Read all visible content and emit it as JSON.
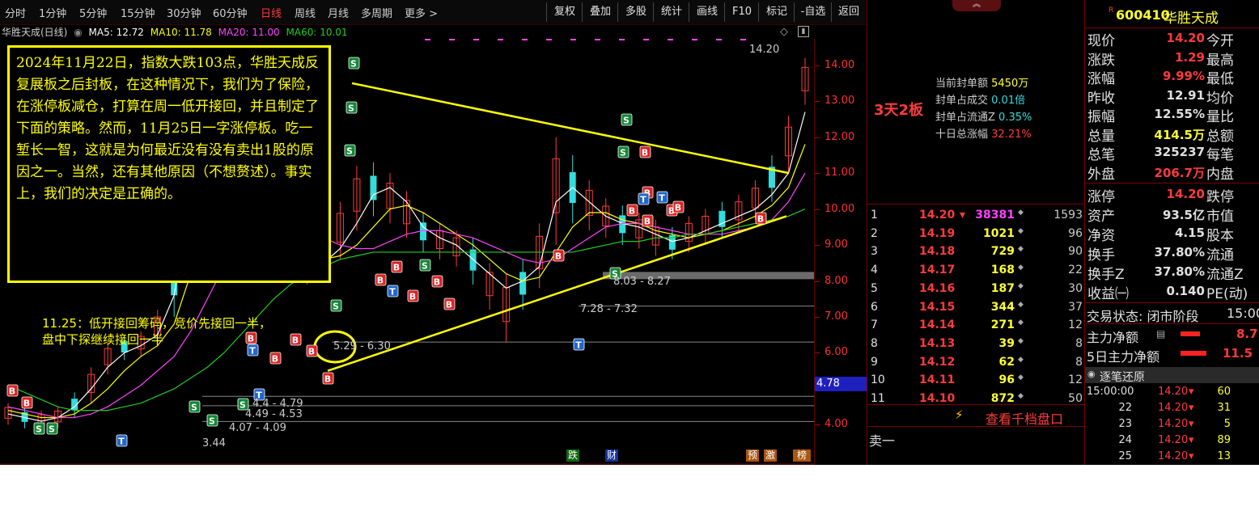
{
  "toolbar": {
    "periods": [
      "分时",
      "1分钟",
      "5分钟",
      "15分钟",
      "30分钟",
      "60分钟",
      "日线",
      "周线",
      "月线",
      "多周期",
      "更多 >"
    ],
    "active_period": "日线",
    "tools": [
      "复权",
      "叠加",
      "多股",
      "统计",
      "画线",
      "F10",
      "标记",
      "-自选",
      "返回"
    ]
  },
  "statusline": {
    "stock": "华胜天成(日线)",
    "ma5": "MA5: 12.72",
    "ma10": "MA10: 11.78",
    "ma20": "MA20: 11.00",
    "ma60": "MA60: 10.01"
  },
  "annotation": {
    "main_text": "2024年11月22日，指数大跌103点，华胜天成反复展板之后封板，在这种情况下，我们为了保险，在涨停板减仓，打算在周一低开接回，并且制定了下面的策略。然而，11月25日一字涨停板。吃一堑长一智，这就是为何最近没有没有卖出1股的原因之一。当然，还有其他原因（不想赘述）。事实上，我们的决定是正确的。",
    "strategy_line1": "11.25：低开接回筹码，竞价先接回一半，",
    "strategy_line2": "盘中下探继续接回一半"
  },
  "chart_labels": {
    "high_label": "14.20",
    "range1": "8.03 - 8.27",
    "range2": "7.28 - 7.32",
    "range3": "5.29 - 6.30",
    "range4": "4.4 - 4.79",
    "range5": "4.49 - 4.53",
    "range6": "4.07 - 4.09",
    "low_label": "3.44",
    "current_price_box": "4.78",
    "bottom_markers": [
      "跌",
      "财",
      "预",
      "激",
      "榜"
    ]
  },
  "chart_data": {
    "type": "line",
    "series": [
      {
        "name": "MA5",
        "values": [
          4.3,
          4.2,
          4.1,
          4.2,
          4.5,
          5.0,
          5.6,
          6.0,
          6.2,
          6.5,
          7.6,
          10.5,
          12.0,
          11.2,
          10.0,
          9.2,
          8.8,
          8.6,
          8.4,
          8.5,
          8.9,
          9.6,
          10.4,
          10.6,
          10.2,
          9.5,
          9.2,
          9.0,
          8.6,
          8.2,
          7.8,
          8.0,
          8.4,
          10.2,
          10.6,
          10.2,
          9.8,
          9.6,
          9.5,
          9.3,
          9.1,
          9.2,
          9.4,
          9.6,
          9.8,
          10.0,
          10.4,
          11.0,
          12.7
        ]
      },
      {
        "name": "MA10",
        "values": [
          4.4,
          4.3,
          4.2,
          4.2,
          4.3,
          4.6,
          5.0,
          5.5,
          5.9,
          6.2,
          6.8,
          8.2,
          9.6,
          10.6,
          10.8,
          10.2,
          9.4,
          9.0,
          8.7,
          8.6,
          8.7,
          9.0,
          9.5,
          10.0,
          10.1,
          9.9,
          9.6,
          9.3,
          9.0,
          8.6,
          8.2,
          8.0,
          8.1,
          8.8,
          9.5,
          9.9,
          9.9,
          9.7,
          9.6,
          9.4,
          9.3,
          9.2,
          9.3,
          9.4,
          9.6,
          9.8,
          10.1,
          10.6,
          11.8
        ]
      },
      {
        "name": "MA20",
        "values": [
          4.5,
          4.4,
          4.3,
          4.2,
          4.2,
          4.3,
          4.5,
          4.8,
          5.1,
          5.5,
          5.9,
          6.6,
          7.5,
          8.4,
          9.1,
          9.6,
          9.7,
          9.6,
          9.4,
          9.2,
          9.0,
          8.9,
          8.9,
          9.1,
          9.3,
          9.4,
          9.4,
          9.3,
          9.2,
          9.0,
          8.8,
          8.6,
          8.5,
          8.6,
          8.9,
          9.2,
          9.5,
          9.6,
          9.6,
          9.5,
          9.4,
          9.3,
          9.3,
          9.3,
          9.4,
          9.5,
          9.7,
          10.2,
          11.0
        ]
      },
      {
        "name": "MA60",
        "values": [
          5.1,
          4.9,
          4.7,
          4.5,
          4.4,
          4.4,
          4.4,
          4.5,
          4.6,
          4.8,
          5.0,
          5.3,
          5.6,
          6.0,
          6.5,
          7.0,
          7.5,
          7.9,
          8.2,
          8.4,
          8.6,
          8.7,
          8.8,
          8.8,
          8.8,
          8.8,
          8.8,
          8.8,
          8.8,
          8.8,
          8.8,
          8.8,
          8.8,
          8.8,
          8.8,
          8.9,
          9.0,
          9.1,
          9.1,
          9.2,
          9.2,
          9.3,
          9.3,
          9.4,
          9.5,
          9.6,
          9.7,
          9.8,
          10.0
        ]
      }
    ],
    "ylim": [
      3.2,
      14.6
    ],
    "yticks": [
      4.0,
      5.0,
      6.0,
      7.0,
      8.0,
      9.0,
      10.0,
      11.0,
      12.0,
      13.0,
      14.0
    ],
    "ytick_labels": [
      "4.00",
      "5.00",
      "6.00",
      "7.00",
      "8.00",
      "9.00",
      "10.00",
      "11.00",
      "12.00",
      "13.00",
      "14.00"
    ],
    "highs": [
      4.6,
      4.5,
      4.4,
      4.5,
      4.9,
      5.6,
      6.3,
      6.5,
      6.6,
      7.2,
      9.0,
      13.6,
      13.2,
      11.6,
      10.4,
      9.6,
      9.0,
      8.8,
      8.7,
      9.2,
      10.2,
      11.2,
      11.3,
      11.0,
      10.5,
      9.9,
      9.6,
      9.4,
      9.2,
      8.5,
      8.2,
      8.6,
      9.6,
      12.0,
      11.5,
      10.8,
      10.3,
      10.1,
      9.9,
      9.7,
      9.5,
      9.8,
      10.0,
      10.2,
      10.4,
      10.8,
      11.5,
      12.6,
      14.2
    ],
    "lows": [
      4.0,
      3.9,
      3.8,
      3.9,
      4.2,
      4.6,
      5.4,
      5.8,
      5.9,
      6.2,
      7.0,
      9.8,
      10.6,
      9.6,
      8.8,
      8.3,
      8.1,
      8.0,
      7.9,
      8.1,
      8.6,
      9.4,
      9.8,
      9.6,
      9.2,
      8.8,
      8.6,
      8.4,
      7.9,
      7.2,
      6.3,
      7.2,
      7.8,
      9.0,
      9.6,
      9.4,
      9.2,
      9.0,
      8.9,
      8.7,
      8.6,
      8.8,
      9.0,
      9.2,
      9.4,
      9.7,
      10.2,
      11.0,
      12.9
    ],
    "trend_upper": {
      "from": [
        11,
        13.5
      ],
      "to": [
        46,
        11.0
      ]
    },
    "trend_lower": {
      "from": [
        9,
        5.5
      ],
      "to": [
        47,
        9.8
      ]
    },
    "hlines": [
      8.15,
      7.3,
      6.3,
      4.79,
      4.53,
      4.09
    ]
  },
  "mid_panel": {
    "streak": "3天2板",
    "stats": [
      {
        "label": "当前封单额",
        "value": "5450万"
      },
      {
        "label": "封单占成交",
        "value": "0.01倍"
      },
      {
        "label": "封单占流通Z",
        "value": "0.35%"
      },
      {
        "label": "十日总涨幅",
        "value": "32.21%"
      }
    ],
    "buy_levels": [
      {
        "n": "1",
        "price": "14.20",
        "vol": "38381",
        "num": "1593"
      },
      {
        "n": "2",
        "price": "14.19",
        "vol": "1021",
        "num": "96"
      },
      {
        "n": "3",
        "price": "14.18",
        "vol": "729",
        "num": "90"
      },
      {
        "n": "4",
        "price": "14.17",
        "vol": "168",
        "num": "22"
      },
      {
        "n": "5",
        "price": "14.16",
        "vol": "187",
        "num": "30"
      },
      {
        "n": "6",
        "price": "14.15",
        "vol": "344",
        "num": "37"
      },
      {
        "n": "7",
        "price": "14.14",
        "vol": "271",
        "num": "12"
      },
      {
        "n": "8",
        "price": "14.13",
        "vol": "39",
        "num": "8"
      },
      {
        "n": "9",
        "price": "14.12",
        "vol": "62",
        "num": "8"
      },
      {
        "n": "10",
        "price": "14.11",
        "vol": "96",
        "num": "12"
      },
      {
        "n": "11",
        "price": "14.10",
        "vol": "872",
        "num": "50"
      }
    ],
    "depth_link": "查看千档盘口",
    "sell_one": "卖一"
  },
  "right_panel": {
    "code": "600410",
    "name": "华胜天成",
    "rows": [
      {
        "l": "现价",
        "v": "14.20",
        "r": "今开",
        "c": "#ff3b3b"
      },
      {
        "l": "涨跌",
        "v": "1.29",
        "r": "最高",
        "c": "#ff3b3b"
      },
      {
        "l": "涨幅",
        "v": "9.99%",
        "r": "最低",
        "c": "#ff3b3b"
      },
      {
        "l": "昨收",
        "v": "12.91",
        "r": "均价",
        "c": "#e0e0e0"
      },
      {
        "l": "振幅",
        "v": "12.55%",
        "r": "量比",
        "c": "#e0e0e0"
      },
      {
        "l": "总量",
        "v": "414.5万",
        "r": "总额",
        "c": "#ffff33"
      },
      {
        "l": "总笔",
        "v": "325237",
        "r": "每笔",
        "c": "#e0e0e0"
      },
      {
        "l": "外盘",
        "v": "206.7万",
        "r": "内盘",
        "c": "#ff3b3b"
      }
    ],
    "rows2": [
      {
        "l": "涨停",
        "v": "14.20",
        "r": "跌停",
        "c": "#ff3b3b"
      },
      {
        "l": "资产",
        "v": "93.5亿",
        "r": "市值",
        "c": "#e0e0e0"
      },
      {
        "l": "净资",
        "v": "4.15",
        "r": "股本",
        "c": "#e0e0e0"
      },
      {
        "l": "换手",
        "v": "37.80%",
        "r": "流通",
        "c": "#e0e0e0"
      },
      {
        "l": "换手Z",
        "v": "37.80%",
        "r": "流通Z",
        "c": "#e0e0e0"
      },
      {
        "l": "收益㈠",
        "v": "0.140",
        "r": "PE(动)",
        "c": "#e0e0e0"
      }
    ],
    "trade_state": "交易状态: 闭市阶段",
    "trade_time": "15:00",
    "main_net": "主力净额",
    "main_net_val": "8.7",
    "main_net5": "5日主力净额",
    "main_net5_val": "11.5",
    "tick_title": "逐笔还原",
    "ticks": [
      {
        "t": "15:00:00",
        "p": "14.20",
        "v": "60"
      },
      {
        "t": "22",
        "p": "14.20",
        "v": "31"
      },
      {
        "t": "23",
        "p": "14.20",
        "v": "5"
      },
      {
        "t": "24",
        "p": "14.20",
        "v": "89"
      },
      {
        "t": "25",
        "p": "14.20",
        "v": "13"
      }
    ]
  },
  "colors": {
    "up": "#ff3b3b",
    "down": "#33dddd",
    "ma5": "#ffffff",
    "ma10": "#ffff00",
    "ma20": "#ff44ff",
    "ma60": "#22cc22",
    "trend": "#ffff00"
  }
}
